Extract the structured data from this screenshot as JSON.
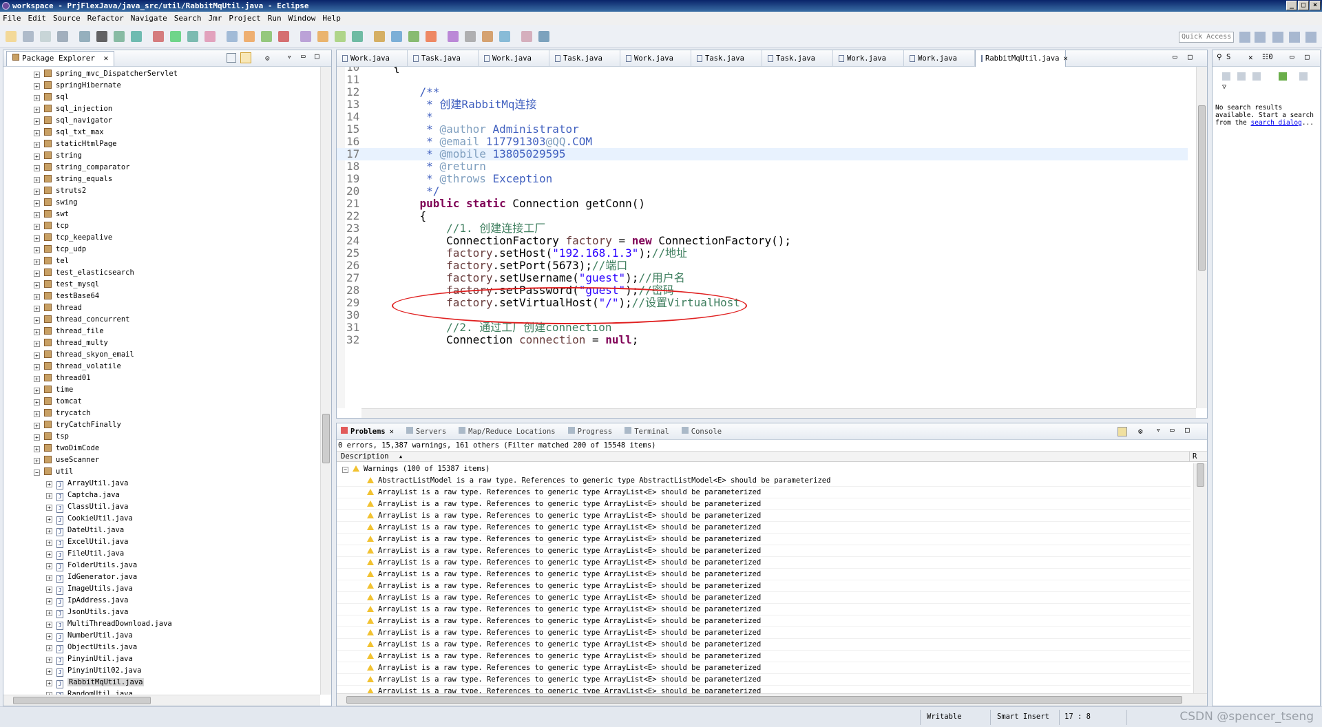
{
  "window": {
    "title": "workspace - PrjFlexJava/java_src/util/RabbitMqUtil.java - Eclipse"
  },
  "menu": [
    "File",
    "Edit",
    "Source",
    "Refactor",
    "Navigate",
    "Search",
    "Jmr",
    "Project",
    "Run",
    "Window",
    "Help"
  ],
  "toolbar": {
    "quick_access": "Quick Access"
  },
  "package_explorer": {
    "title": "Package Explorer",
    "packages": [
      "spring_mvc_DispatcherServlet",
      "springHibernate",
      "sql",
      "sql_injection",
      "sql_navigator",
      "sql_txt_max",
      "staticHtmlPage",
      "string",
      "string_comparator",
      "string_equals",
      "struts2",
      "swing",
      "swt",
      "tcp",
      "tcp_keepalive",
      "tcp_udp",
      "tel",
      "test_elasticsearch",
      "test_mysql",
      "testBase64",
      "thread",
      "thread_concurrent",
      "thread_file",
      "thread_multy",
      "thread_skyon_email",
      "thread_volatile",
      "thread01",
      "time",
      "tomcat",
      "trycatch",
      "tryCatchFinally",
      "tsp",
      "twoDimCode",
      "useScanner",
      "util"
    ],
    "files": [
      "ArrayUtil.java",
      "Captcha.java",
      "ClassUtil.java",
      "CookieUtil.java",
      "DateUtil.java",
      "ExcelUtil.java",
      "FileUtil.java",
      "FolderUtils.java",
      "IdGenerator.java",
      "ImageUtils.java",
      "IpAddress.java",
      "JsonUtils.java",
      "MultiThreadDownload.java",
      "NumberUtil.java",
      "ObjectUtils.java",
      "PinyinUtil.java",
      "PinyinUtil02.java",
      "RabbitMqUtil.java",
      "RandomUtil.java"
    ],
    "selected_file": "RabbitMqUtil.java"
  },
  "editor": {
    "tabs": [
      "Work.java",
      "Task.java",
      "Work.java",
      "Task.java",
      "Work.java",
      "Task.java",
      "Task.java",
      "Work.java",
      "Work.java",
      "RabbitMqUtil.java"
    ],
    "active_tab": "RabbitMqUtil.java",
    "lines": [
      {
        "n": "10",
        "code": "{"
      },
      {
        "n": "11",
        "code": ""
      },
      {
        "n": "12",
        "code": "    /**"
      },
      {
        "n": "13",
        "code": "     * 创建RabbitMq连接"
      },
      {
        "n": "14",
        "code": "     *"
      },
      {
        "n": "15",
        "code": "     * @author Administrator"
      },
      {
        "n": "16",
        "code": "     * @email 117791303@QQ.COM"
      },
      {
        "n": "17",
        "code": "     * @mobile 13805029595"
      },
      {
        "n": "18",
        "code": "     * @return"
      },
      {
        "n": "19",
        "code": "     * @throws Exception"
      },
      {
        "n": "20",
        "code": "     */"
      },
      {
        "n": "21",
        "code": "    public static Connection getConn()"
      },
      {
        "n": "22",
        "code": "    {"
      },
      {
        "n": "23",
        "code": "        //1. 创建连接工厂"
      },
      {
        "n": "24",
        "code": "        ConnectionFactory factory = new ConnectionFactory();"
      },
      {
        "n": "25",
        "code": "        factory.setHost(\"192.168.1.3\");//地址"
      },
      {
        "n": "26",
        "code": "        factory.setPort(5673);//端口"
      },
      {
        "n": "27",
        "code": "        factory.setUsername(\"guest\");//用户名"
      },
      {
        "n": "28",
        "code": "        factory.setPassword(\"guest\");//密码"
      },
      {
        "n": "29",
        "code": "        factory.setVirtualHost(\"/\");//设置VirtualHost"
      },
      {
        "n": "30",
        "code": ""
      },
      {
        "n": "31",
        "code": "        //2. 通过工厂创建connection"
      },
      {
        "n": "32",
        "code": "        Connection connection = null;"
      }
    ]
  },
  "search_view": {
    "tab": "S",
    "tab2": "0",
    "message": "No search results available. Start a search from the",
    "link": "search dialog",
    "suffix": "..."
  },
  "problems": {
    "tabs": [
      "Problems",
      "Servers",
      "Map/Reduce Locations",
      "Progress",
      "Terminal",
      "Console"
    ],
    "summary": "0 errors, 15,387 warnings, 161 others (Filter matched 200 of 15548 items)",
    "column": "Description",
    "column2": "R",
    "group": "Warnings (100 of 15387 items)",
    "first_row": "AbstractListModel is a raw type. References to generic type AbstractListModel<E> should be parameterized",
    "row_text": "ArrayList is a raw type. References to generic type ArrayList<E> should be parameterized",
    "row_count": 18
  },
  "status": {
    "writable": "Writable",
    "insert": "Smart Insert",
    "position": "17 : 8",
    "watermark": "CSDN @spencer_tseng"
  },
  "colors": {
    "keyword": "#7f0055",
    "comment": "#3f7f5f",
    "javadoc": "#3f5fbf",
    "string": "#2a00ff",
    "field": "#0000c0",
    "annotation_oval": "#e02020"
  }
}
